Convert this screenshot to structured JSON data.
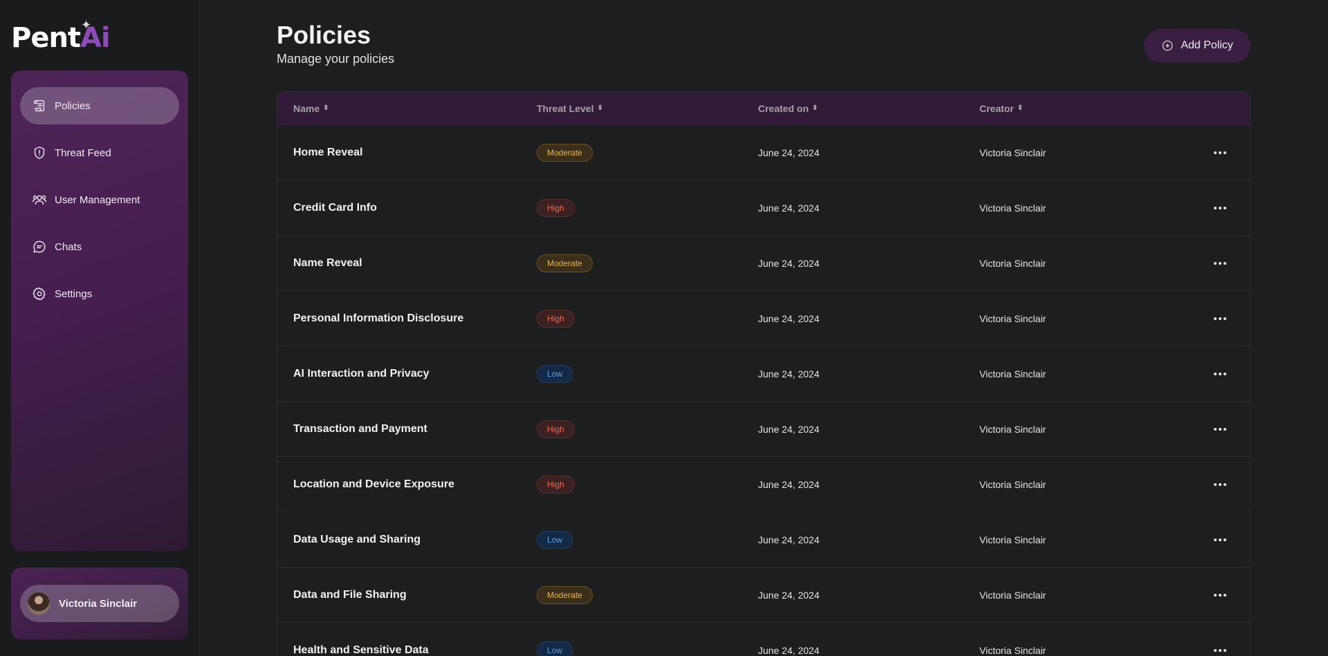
{
  "brand": {
    "name_part1": "Pent",
    "name_part2": "Ai"
  },
  "sidebar": {
    "items": [
      {
        "label": "Policies",
        "icon": "scroll-icon",
        "active": true
      },
      {
        "label": "Threat Feed",
        "icon": "shield-alert-icon",
        "active": false
      },
      {
        "label": "User Management",
        "icon": "users-icon",
        "active": false
      },
      {
        "label": "Chats",
        "icon": "chat-bubble-icon",
        "active": false
      },
      {
        "label": "Settings",
        "icon": "gear-icon",
        "active": false
      }
    ],
    "user": {
      "name": "Victoria Sinclair"
    }
  },
  "header": {
    "title": "Policies",
    "subtitle": "Manage your policies",
    "add_button_label": "Add Policy"
  },
  "table": {
    "columns": [
      "Name",
      "Threat Level",
      "Created on",
      "Creator"
    ],
    "rows": [
      {
        "name": "Home Reveal",
        "threat": "Moderate",
        "created": "June 24, 2024",
        "creator": "Victoria Sinclair"
      },
      {
        "name": "Credit Card Info",
        "threat": "High",
        "created": "June 24, 2024",
        "creator": "Victoria Sinclair"
      },
      {
        "name": "Name Reveal",
        "threat": "Moderate",
        "created": "June 24, 2024",
        "creator": "Victoria Sinclair"
      },
      {
        "name": "Personal Information Disclosure",
        "threat": "High",
        "created": "June 24, 2024",
        "creator": "Victoria Sinclair"
      },
      {
        "name": "AI Interaction and Privacy",
        "threat": "Low",
        "created": "June 24, 2024",
        "creator": "Victoria Sinclair"
      },
      {
        "name": "Transaction and Payment",
        "threat": "High",
        "created": "June 24, 2024",
        "creator": "Victoria Sinclair"
      },
      {
        "name": "Location and Device Exposure",
        "threat": "High",
        "created": "June 24, 2024",
        "creator": "Victoria Sinclair"
      },
      {
        "name": "Data Usage and Sharing",
        "threat": "Low",
        "created": "June 24, 2024",
        "creator": "Victoria Sinclair"
      },
      {
        "name": "Data and File Sharing",
        "threat": "Moderate",
        "created": "June 24, 2024",
        "creator": "Victoria Sinclair"
      },
      {
        "name": "Health and Sensitive Data",
        "threat": "Low",
        "created": "June 24, 2024",
        "creator": "Victoria Sinclair"
      }
    ]
  },
  "colors": {
    "accent": "#8d4bb8",
    "moderate": "#e9b646",
    "high": "#ec6a55",
    "low": "#5aa3ea"
  }
}
